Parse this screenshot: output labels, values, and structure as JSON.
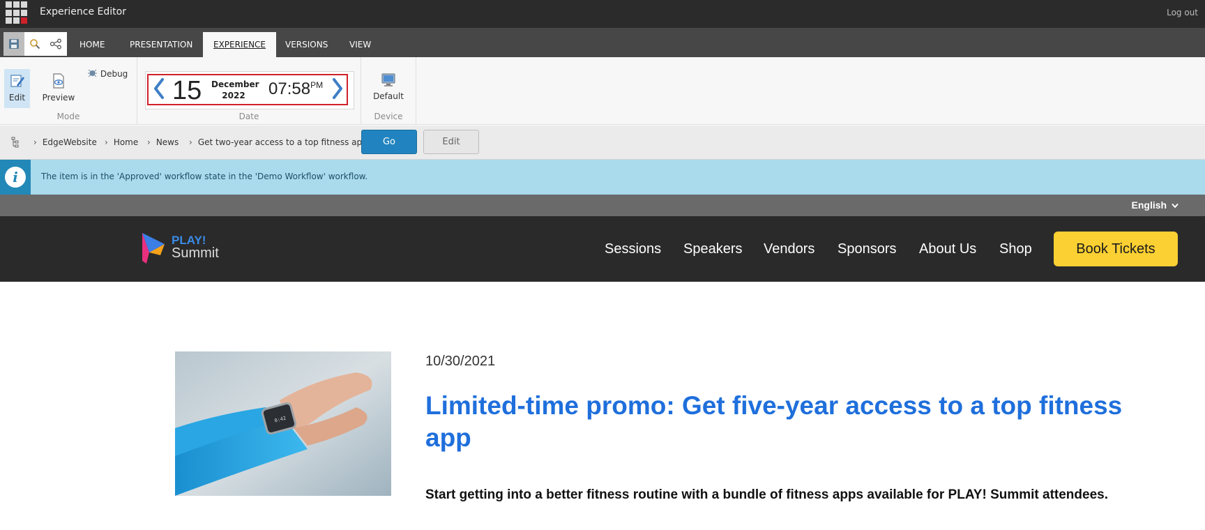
{
  "app": {
    "title": "Experience Editor",
    "logout": "Log out"
  },
  "quick_access": [
    {
      "icon": "save-icon"
    },
    {
      "icon": "search-icon"
    },
    {
      "icon": "share-icon"
    }
  ],
  "tabs": [
    {
      "label": "HOME"
    },
    {
      "label": "PRESENTATION"
    },
    {
      "label": "EXPERIENCE",
      "active": true
    },
    {
      "label": "VERSIONS"
    },
    {
      "label": "VIEW"
    }
  ],
  "ribbon": {
    "mode": {
      "group_label": "Mode",
      "edit_label": "Edit",
      "preview_label": "Preview",
      "debug_label": "Debug"
    },
    "date": {
      "group_label": "Date",
      "day": "15",
      "month": "December",
      "year": "2022",
      "time": "07:58",
      "ampm": "PM"
    },
    "device": {
      "group_label": "Device",
      "default_label": "Default"
    }
  },
  "breadcrumb": {
    "items": [
      "EdgeWebsite",
      "Home",
      "News",
      "Get two-year access to a top fitness app"
    ],
    "go_label": "Go",
    "edit_label": "Edit"
  },
  "info": {
    "message": "The item is in the 'Approved' workflow state in the 'Demo Workflow' workflow."
  },
  "language": {
    "selected": "English"
  },
  "site": {
    "logo_line1": "PLAY!",
    "logo_line2": "Summit",
    "nav": [
      "Sessions",
      "Speakers",
      "Vendors",
      "Sponsors",
      "About Us",
      "Shop"
    ],
    "cta": "Book Tickets"
  },
  "article": {
    "date": "10/30/2021",
    "title": "Limited-time promo: Get five-year access to a top fitness app",
    "lead": "Start getting into a better fitness routine with a bundle of fitness apps available for PLAY! Summit attendees."
  },
  "colors": {
    "topbar": "#2b2b2b",
    "accent_blue": "#2184c0",
    "info_bg": "#a9dbed",
    "title_blue": "#1f6fdc",
    "cta_yellow": "#fbd033",
    "highlight_red": "#d0202a"
  }
}
